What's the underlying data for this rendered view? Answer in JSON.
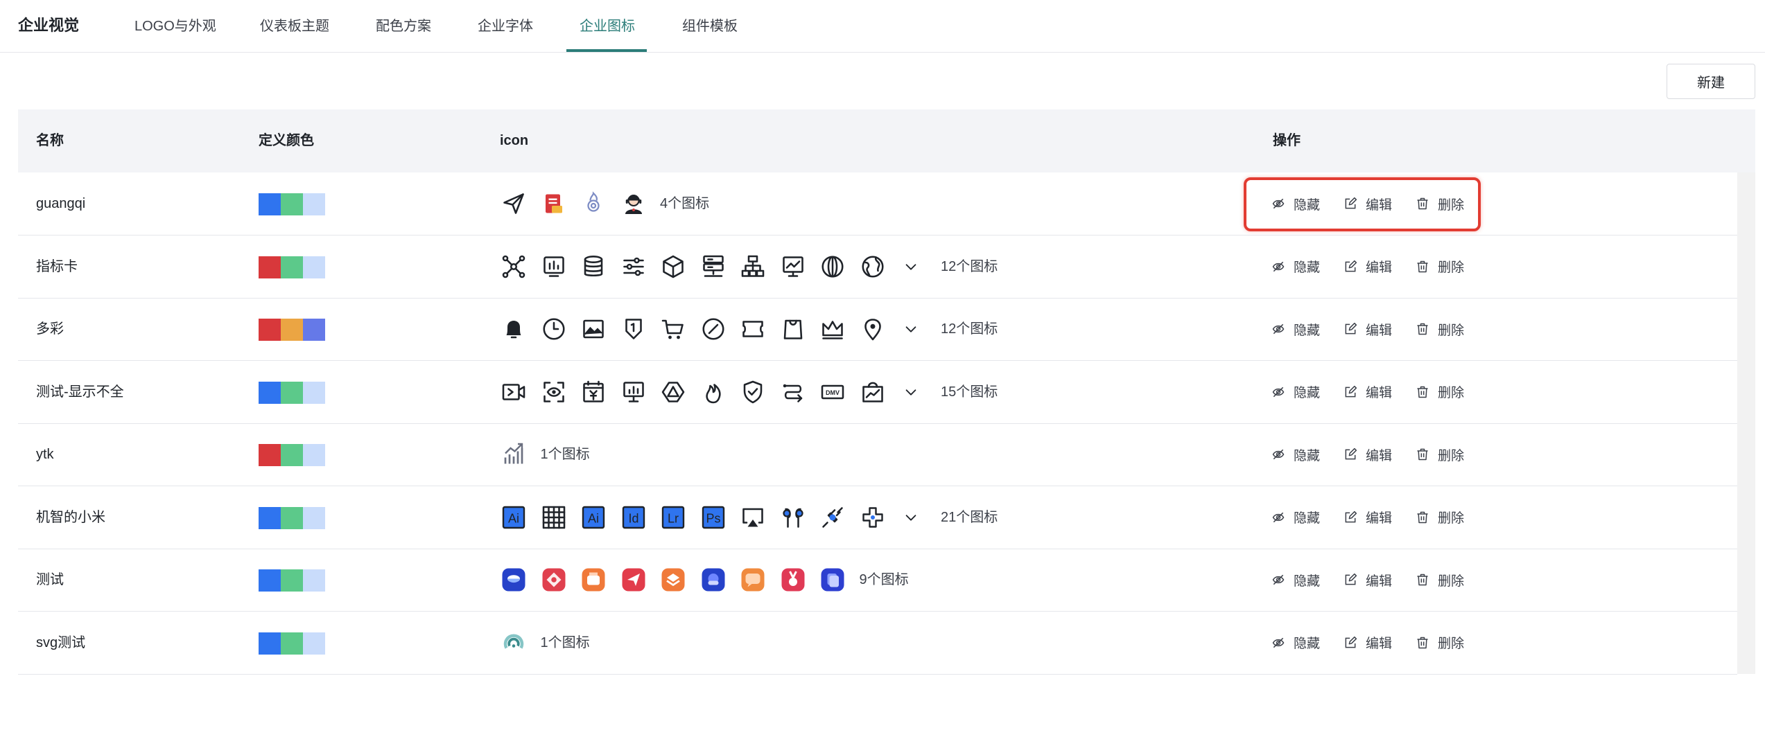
{
  "brand": "企业视觉",
  "tabs": [
    {
      "label": "LOGO与外观"
    },
    {
      "label": "仪表板主题"
    },
    {
      "label": "配色方案"
    },
    {
      "label": "企业字体"
    },
    {
      "label": "企业图标",
      "active": true
    },
    {
      "label": "组件模板"
    }
  ],
  "new_button": "新建",
  "table": {
    "headers": {
      "name": "名称",
      "color": "定义颜色",
      "icon": "icon",
      "ops": "操作"
    },
    "actions": {
      "hide": "隐藏",
      "edit": "编辑",
      "delete": "删除"
    },
    "rows": [
      {
        "name": "guangqi",
        "colors": [
          "#2f74ef",
          "#5cc98a",
          "#c9dcfb"
        ],
        "icons": [
          "paper-plane-icon",
          "document-icon",
          "flame-gear-icon",
          "customer-service-icon"
        ],
        "expandable": false,
        "count": "4个图标"
      },
      {
        "name": "指标卡",
        "colors": [
          "#d8383b",
          "#5cc98a",
          "#c9dcfb"
        ],
        "icons": [
          "network-icon",
          "chart-board-icon",
          "database-icon",
          "sliders-icon",
          "cube-icon",
          "server-icon",
          "org-chart-icon",
          "monitor-chart-icon",
          "globe-icon",
          "earth-icon"
        ],
        "expandable": true,
        "count": "12个图标"
      },
      {
        "name": "多彩",
        "colors": [
          "#d8383b",
          "#eba543",
          "#6579e8"
        ],
        "icons": [
          "bell-icon",
          "clock-icon",
          "image-icon",
          "shield-badge-icon",
          "cart-icon",
          "compass-icon",
          "ticket-icon",
          "bag-icon",
          "crown-icon",
          "location-pin-icon"
        ],
        "expandable": true,
        "count": "12个图标"
      },
      {
        "name": "测试-显示不全",
        "colors": [
          "#2f74ef",
          "#5cc98a",
          "#c9dcfb"
        ],
        "icons": [
          "video-icon",
          "scan-eye-icon",
          "yen-calendar-icon",
          "presentation-icon",
          "triangle-alert-icon",
          "fire-icon",
          "shield-check-icon",
          "route-icon",
          "ticket-text-icon",
          "bag-chart-icon"
        ],
        "expandable": true,
        "count": "15个图标"
      },
      {
        "name": "ytk",
        "colors": [
          "#d8383b",
          "#5cc98a",
          "#c9dcfb"
        ],
        "icons": [
          "growth-chart-icon"
        ],
        "expandable": false,
        "count": "1个图标"
      },
      {
        "name": "机智的小米",
        "colors": [
          "#2f74ef",
          "#5cc98a",
          "#c9dcfb"
        ],
        "icons": [
          "illustrator-icon",
          "grid-icon",
          "illustrator-alt-icon",
          "indesign-icon",
          "lightroom-icon",
          "photoshop-icon",
          "airplay-icon",
          "earbuds-icon",
          "plug-icon",
          "propeller-icon"
        ],
        "expandable": true,
        "count": "21个图标"
      },
      {
        "name": "测试",
        "colors": [
          "#2f74ef",
          "#5cc98a",
          "#c9dcfb"
        ],
        "icons": [
          "app-blue-icon",
          "app-red-icon",
          "app-orange-icon",
          "app-send-icon",
          "app-layers-icon",
          "app-chat-blue-icon",
          "app-chat-orange-icon",
          "app-medal-icon",
          "app-copy-icon"
        ],
        "expandable": false,
        "count": "9个图标"
      },
      {
        "name": "svg测试",
        "colors": [
          "#2f74ef",
          "#5cc98a",
          "#c9dcfb"
        ],
        "icons": [
          "gauge-icon"
        ],
        "expandable": false,
        "count": "1个图标"
      }
    ]
  },
  "colors": {
    "accent": "#2c7d79",
    "highlight": "#e23c32"
  }
}
